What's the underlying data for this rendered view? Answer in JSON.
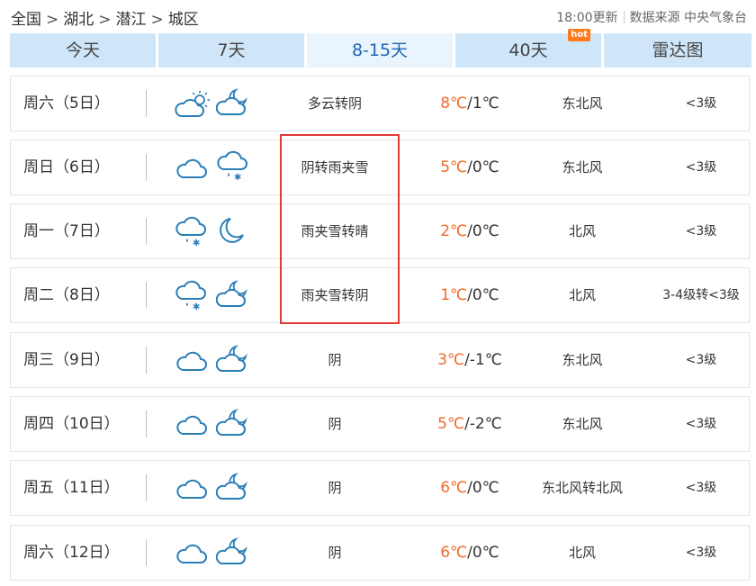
{
  "breadcrumb": [
    "全国",
    "湖北",
    "潜江",
    "城区"
  ],
  "breadcrumb_sep": ">",
  "update_text": "18:00更新",
  "source_label": "数据来源",
  "source_name": "中央气象台",
  "tabs": [
    {
      "label": "今天"
    },
    {
      "label": "7天"
    },
    {
      "label": "8-15天",
      "active": true
    },
    {
      "label": "40天",
      "badge": "hot"
    },
    {
      "label": "雷达图"
    }
  ],
  "forecast": [
    {
      "day": "周六（5日）",
      "icon_day": "partly-cloudy-sun",
      "icon_night": "cloudy-moon",
      "weather": "多云转阴",
      "high": "8℃",
      "low": "/1℃",
      "wind": "东北风",
      "level": "<3级"
    },
    {
      "day": "周日（6日）",
      "icon_day": "cloudy",
      "icon_night": "sleet",
      "weather": "阴转雨夹雪",
      "high": "5℃",
      "low": "/0℃",
      "wind": "东北风",
      "level": "<3级"
    },
    {
      "day": "周一（7日）",
      "icon_day": "sleet",
      "icon_night": "crescent-moon",
      "weather": "雨夹雪转晴",
      "high": "2℃",
      "low": "/0℃",
      "wind": "北风",
      "level": "<3级"
    },
    {
      "day": "周二（8日）",
      "icon_day": "sleet",
      "icon_night": "cloudy-moon",
      "weather": "雨夹雪转阴",
      "high": "1℃",
      "low": "/0℃",
      "wind": "北风",
      "level": "3-4级转<3级"
    },
    {
      "day": "周三（9日）",
      "icon_day": "cloudy",
      "icon_night": "cloudy-moon",
      "weather": "阴",
      "high": "3℃",
      "low": "/-1℃",
      "wind": "东北风",
      "level": "<3级"
    },
    {
      "day": "周四（10日）",
      "icon_day": "cloudy",
      "icon_night": "cloudy-moon",
      "weather": "阴",
      "high": "5℃",
      "low": "/-2℃",
      "wind": "东北风",
      "level": "<3级"
    },
    {
      "day": "周五（11日）",
      "icon_day": "cloudy",
      "icon_night": "cloudy-moon",
      "weather": "阴",
      "high": "6℃",
      "low": "/0℃",
      "wind": "东北风转北风",
      "level": "<3级"
    },
    {
      "day": "周六（12日）",
      "icon_day": "cloudy",
      "icon_night": "cloudy-moon",
      "weather": "阴",
      "high": "6℃",
      "low": "/0℃",
      "wind": "北风",
      "level": "<3级"
    }
  ],
  "colors": {
    "tab_bg": "#cfe5f8",
    "tab_active_text": "#1c66b5",
    "temp_high": "#ee6a2a",
    "icon_stroke": "#2b7fb8",
    "highlight": "#e53935"
  }
}
